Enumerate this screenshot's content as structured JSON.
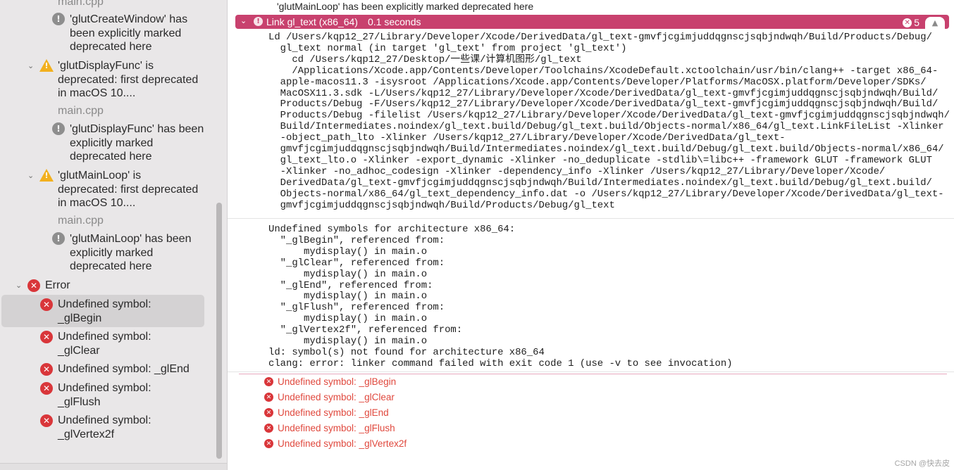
{
  "sidebar": {
    "file_top": "main.cpp",
    "glutCreateWindow_note": "'glutCreateWindow' has been explicitly marked deprecated here",
    "display_warning": "'glutDisplayFunc' is deprecated: first deprecated in macOS 10....",
    "display_file": "main.cpp",
    "display_note": "'glutDisplayFunc' has been explicitly marked deprecated here",
    "mainloop_warning": "'glutMainLoop' is deprecated: first deprecated in macOS 10....",
    "mainloop_file": "main.cpp",
    "mainloop_note": "'glutMainLoop' has been explicitly marked deprecated here",
    "error_group": "Error",
    "errors": [
      "Undefined symbol: _glBegin",
      "Undefined symbol: _glClear",
      "Undefined symbol: _glEnd",
      "Undefined symbol: _glFlush",
      "Undefined symbol: _glVertex2f"
    ]
  },
  "log": {
    "top_message": "'glutMainLoop' has been explicitly marked deprecated here",
    "link_title": "Link gl_text (x86_64)",
    "link_time": "0.1 seconds",
    "error_count": "5",
    "command": "Ld /Users/kqp12_27/Library/Developer/Xcode/DerivedData/gl_text-gmvfjcgimjuddqgnscjsqbjndwqh/Build/Products/Debug/\n  gl_text normal (in target 'gl_text' from project 'gl_text')\n    cd /Users/kqp12_27/Desktop/一些课/计算机图形/gl_text\n    /Applications/Xcode.app/Contents/Developer/Toolchains/XcodeDefault.xctoolchain/usr/bin/clang++ -target x86_64-\n  apple-macos11.3 -isysroot /Applications/Xcode.app/Contents/Developer/Platforms/MacOSX.platform/Developer/SDKs/\n  MacOSX11.3.sdk -L/Users/kqp12_27/Library/Developer/Xcode/DerivedData/gl_text-gmvfjcgimjuddqgnscjsqbjndwqh/Build/\n  Products/Debug -F/Users/kqp12_27/Library/Developer/Xcode/DerivedData/gl_text-gmvfjcgimjuddqgnscjsqbjndwqh/Build/\n  Products/Debug -filelist /Users/kqp12_27/Library/Developer/Xcode/DerivedData/gl_text-gmvfjcgimjuddqgnscjsqbjndwqh/\n  Build/Intermediates.noindex/gl_text.build/Debug/gl_text.build/Objects-normal/x86_64/gl_text.LinkFileList -Xlinker\n  -object_path_lto -Xlinker /Users/kqp12_27/Library/Developer/Xcode/DerivedData/gl_text-\n  gmvfjcgimjuddqgnscjsqbjndwqh/Build/Intermediates.noindex/gl_text.build/Debug/gl_text.build/Objects-normal/x86_64/\n  gl_text_lto.o -Xlinker -export_dynamic -Xlinker -no_deduplicate -stdlib\\=libc++ -framework GLUT -framework GLUT\n  -Xlinker -no_adhoc_codesign -Xlinker -dependency_info -Xlinker /Users/kqp12_27/Library/Developer/Xcode/\n  DerivedData/gl_text-gmvfjcgimjuddqgnscjsqbjndwqh/Build/Intermediates.noindex/gl_text.build/Debug/gl_text.build/\n  Objects-normal/x86_64/gl_text_dependency_info.dat -o /Users/kqp12_27/Library/Developer/Xcode/DerivedData/gl_text-\n  gmvfjcgimjuddqgnscjsqbjndwqh/Build/Products/Debug/gl_text",
    "undefined": "Undefined symbols for architecture x86_64:\n  \"_glBegin\", referenced from:\n      mydisplay() in main.o\n  \"_glClear\", referenced from:\n      mydisplay() in main.o\n  \"_glEnd\", referenced from:\n      mydisplay() in main.o\n  \"_glFlush\", referenced from:\n      mydisplay() in main.o\n  \"_glVertex2f\", referenced from:\n      mydisplay() in main.o\nld: symbol(s) not found for architecture x86_64\nclang: error: linker command failed with exit code 1 (use -v to see invocation)",
    "error_lines": [
      "Undefined symbol: _glBegin",
      "Undefined symbol: _glClear",
      "Undefined symbol: _glEnd",
      "Undefined symbol: _glFlush",
      "Undefined symbol: _glVertex2f"
    ]
  },
  "watermark": "CSDN @快去皮",
  "colors": {
    "error": "#d9363a",
    "link_bar": "#c8416e",
    "warning": "#f2b01e",
    "error_text": "#e0483d"
  },
  "icons": {
    "error": "x-circle-icon",
    "warning": "warning-triangle-icon",
    "info": "exclamation-circle-icon"
  }
}
